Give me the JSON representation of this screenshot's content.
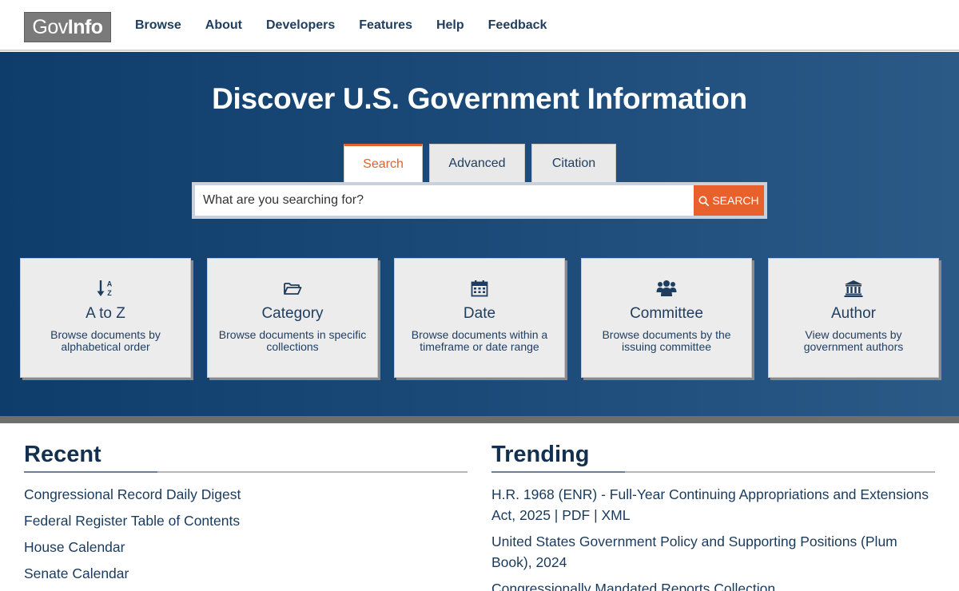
{
  "header": {
    "logo_gov": "Gov",
    "logo_info": "Info",
    "nav": [
      "Browse",
      "About",
      "Developers",
      "Features",
      "Help",
      "Feedback"
    ]
  },
  "hero": {
    "title": "Discover U.S. Government Information",
    "tabs": [
      "Search",
      "Advanced",
      "Citation"
    ],
    "active_tab": "Search",
    "search_placeholder": "What are you searching for?",
    "search_button": "SEARCH"
  },
  "cards": [
    {
      "icon": "sort-alpha-icon",
      "title": "A to Z",
      "desc": "Browse documents by alphabetical order"
    },
    {
      "icon": "folder-open-icon",
      "title": "Category",
      "desc": "Browse documents in specific collections"
    },
    {
      "icon": "calendar-icon",
      "title": "Date",
      "desc": "Browse documents within a timeframe or date range"
    },
    {
      "icon": "users-icon",
      "title": "Committee",
      "desc": "Browse documents by the issuing committee"
    },
    {
      "icon": "institution-icon",
      "title": "Author",
      "desc": "View documents by government authors"
    }
  ],
  "recent": {
    "heading": "Recent",
    "items": [
      "Congressional Record Daily Digest",
      "Federal Register Table of Contents",
      "House Calendar",
      "Senate Calendar"
    ]
  },
  "trending": {
    "heading": "Trending",
    "items": [
      "H.R. 1968 (ENR) - Full-Year Continuing Appropriations and Extensions Act, 2025 | PDF | XML",
      "United States Government Policy and Supporting Positions (Plum Book), 2024",
      "Congressionally Mandated Reports Collection"
    ]
  },
  "colors": {
    "brand_navy": "#1f3d5f",
    "accent_orange": "#e8612d",
    "hero_start": "#0f3d6b",
    "hero_end": "#2c5a87"
  }
}
